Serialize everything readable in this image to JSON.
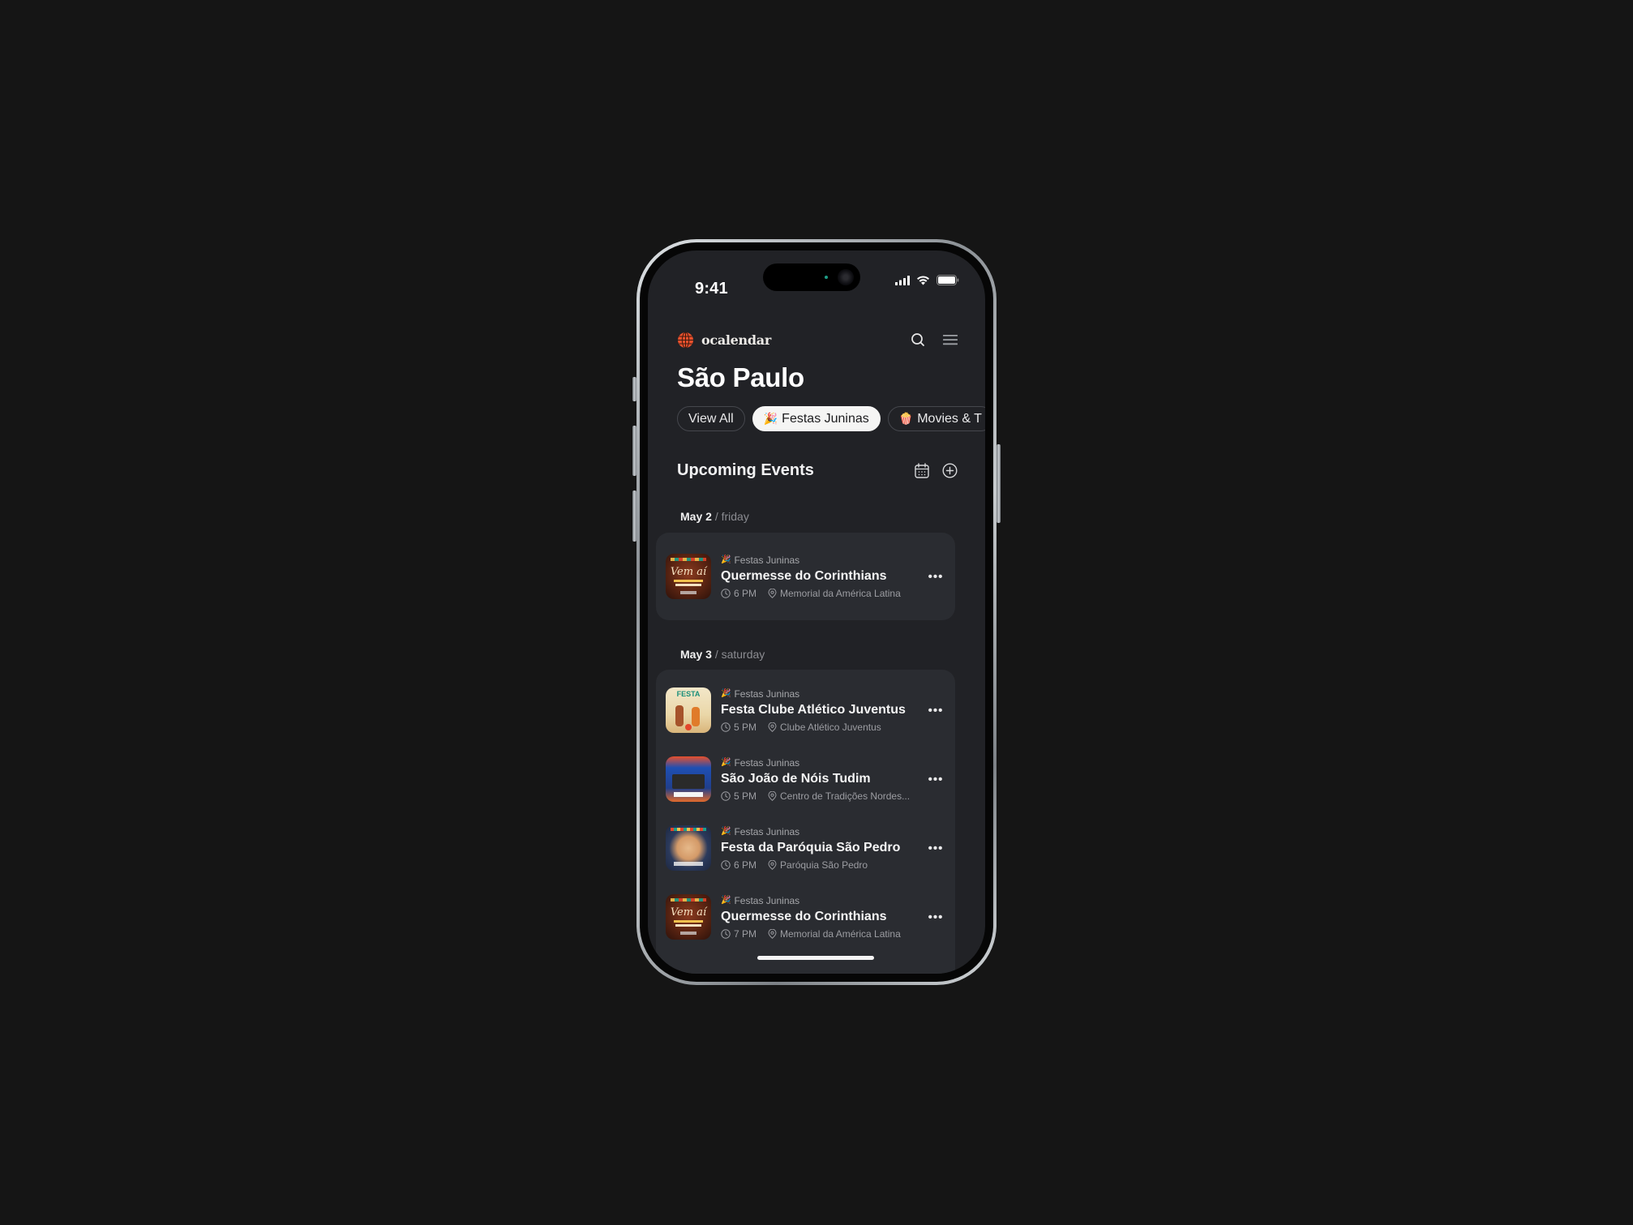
{
  "status_bar": {
    "time": "9:41"
  },
  "app": {
    "name": "ocalendar",
    "brand_color": "#e8502c"
  },
  "header": {
    "icons": [
      "search-icon",
      "menu-icon"
    ]
  },
  "city": "São Paulo",
  "filters": [
    {
      "emoji": "",
      "label": "View All",
      "active": false
    },
    {
      "emoji": "🎉",
      "label": "Festas Juninas",
      "active": true
    },
    {
      "emoji": "🍿",
      "label": "Movies & T",
      "active": false
    }
  ],
  "section": {
    "title": "Upcoming Events",
    "icons": [
      "calendar-icon",
      "add-circle-icon"
    ]
  },
  "days": [
    {
      "date": "May 2",
      "weekday": "/ friday",
      "events": [
        {
          "category_emoji": "🎉",
          "category": "Festas Juninas",
          "title": "Quermesse do Corinthians",
          "time": "6 PM",
          "venue": "Memorial da América Latina",
          "thumb": "corinthians"
        }
      ]
    },
    {
      "date": "May 3",
      "weekday": "/ saturday",
      "events": [
        {
          "category_emoji": "🎉",
          "category": "Festas Juninas",
          "title": "Festa Clube Atlético Juventus",
          "time": "5 PM",
          "venue": "Clube Atlético Juventus",
          "thumb": "juventus"
        },
        {
          "category_emoji": "🎉",
          "category": "Festas Juninas",
          "title": "São João de Nóis Tudim",
          "time": "5 PM",
          "venue": "Centro de Tradições Nordes...",
          "thumb": "nordestino"
        },
        {
          "category_emoji": "🎉",
          "category": "Festas Juninas",
          "title": "Festa da Paróquia São Pedro",
          "time": "6 PM",
          "venue": "Paróquia São Pedro",
          "thumb": "saopedro"
        },
        {
          "category_emoji": "🎉",
          "category": "Festas Juninas",
          "title": "Quermesse do Corinthians",
          "time": "7 PM",
          "venue": "Memorial da América Latina",
          "thumb": "corinthians"
        }
      ]
    }
  ],
  "more_label": "•••"
}
